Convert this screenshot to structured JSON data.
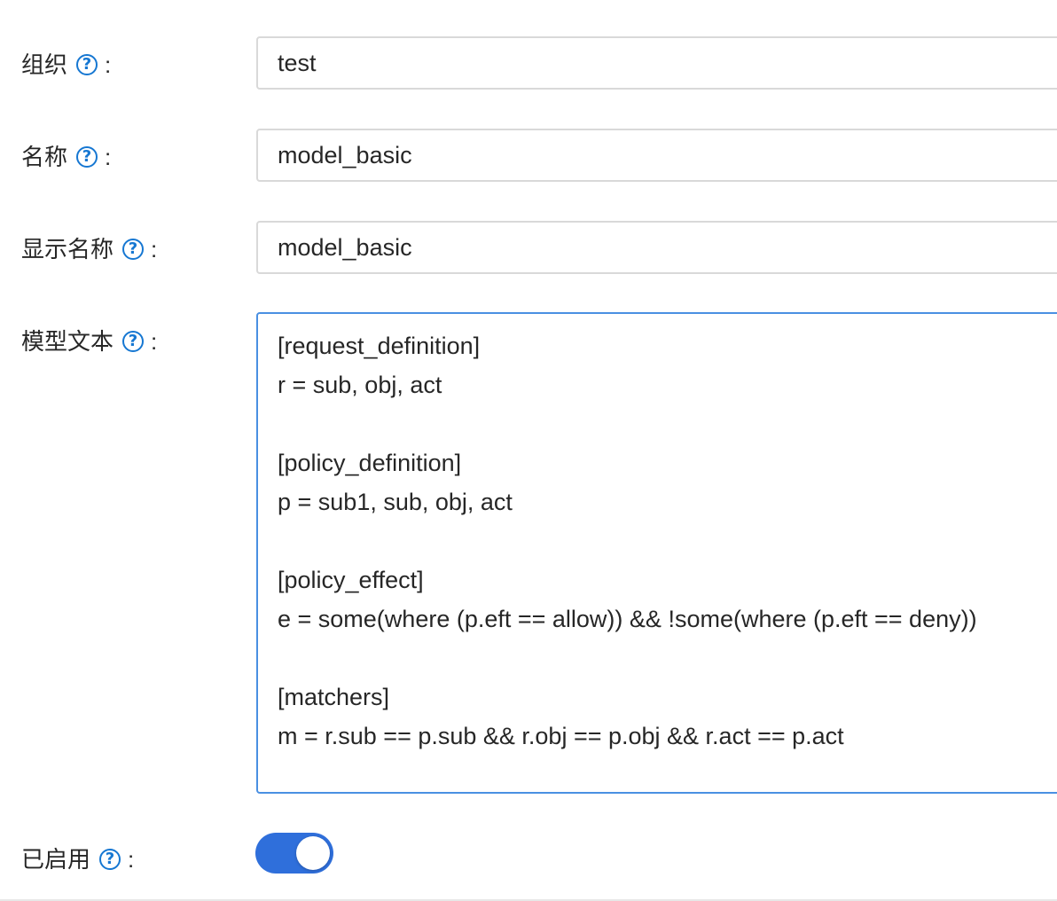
{
  "form": {
    "organization": {
      "label": "组织",
      "colon": ":",
      "help_icon": "question-circle-icon",
      "value": "test"
    },
    "name": {
      "label": "名称",
      "colon": ":",
      "help_icon": "question-circle-icon",
      "value": "model_basic"
    },
    "display_name": {
      "label": "显示名称",
      "colon": ":",
      "help_icon": "question-circle-icon",
      "value": "model_basic"
    },
    "model_text": {
      "label": "模型文本",
      "colon": ":",
      "help_icon": "question-circle-icon",
      "value": "[request_definition]\nr = sub, obj, act\n\n[policy_definition]\np = sub1, sub, obj, act\n\n[policy_effect]\ne = some(where (p.eft == allow)) && !some(where (p.eft == deny))\n\n[matchers]\nm = r.sub == p.sub && r.obj == p.obj && r.act == p.act"
    },
    "enabled": {
      "label": "已启用",
      "colon": ":",
      "help_icon": "question-circle-icon",
      "checked": true
    }
  },
  "colors": {
    "accent": "#2f6fdb",
    "help_icon": "#1677d2",
    "focus_border": "#4a90e2",
    "input_border": "#d9d9d9"
  }
}
